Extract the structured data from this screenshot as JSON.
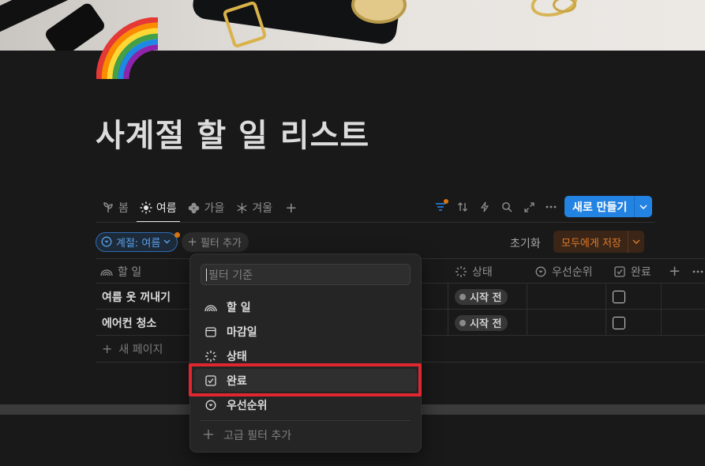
{
  "page": {
    "title": "사계절 할 일 리스트",
    "icon": "rainbow-icon"
  },
  "tabs": [
    {
      "label": "봄",
      "icon": "sprout-icon"
    },
    {
      "label": "여름",
      "icon": "sun-icon",
      "active": true
    },
    {
      "label": "가을",
      "icon": "clover-icon"
    },
    {
      "label": "겨울",
      "icon": "snowflake-icon"
    }
  ],
  "toolbar": {
    "new_label": "새로 만들기",
    "icons": [
      "filter-icon",
      "sort-icon",
      "lightning-icon",
      "search-icon",
      "expand-icon",
      "more-icon"
    ]
  },
  "filters": {
    "active_chip": "계절: 여름",
    "add_label": "필터 추가",
    "reset_label": "초기화",
    "save_label": "모두에게 저장"
  },
  "table": {
    "columns": [
      "할 일",
      "상태",
      "우선순위",
      "완료"
    ],
    "rows": [
      {
        "name": "여름 옷 꺼내기",
        "status": "시작 전",
        "done": false
      },
      {
        "name": "에어컨 청소",
        "status": "시작 전",
        "done": false
      }
    ],
    "new_page_label": "새 페이지"
  },
  "filter_menu": {
    "search_placeholder": "필터 기준",
    "items": [
      {
        "label": "할 일",
        "icon": "rainbow-title-icon"
      },
      {
        "label": "마감일",
        "icon": "calendar-icon"
      },
      {
        "label": "상태",
        "icon": "status-icon"
      },
      {
        "label": "완료",
        "icon": "checkbox-icon",
        "highlighted": true
      },
      {
        "label": "우선순위",
        "icon": "select-icon"
      }
    ],
    "advanced_label": "고급 필터 추가"
  },
  "colors": {
    "accent": "#2383e2",
    "highlight": "#e0262f",
    "save": "#e07a2a",
    "background": "#191919"
  }
}
